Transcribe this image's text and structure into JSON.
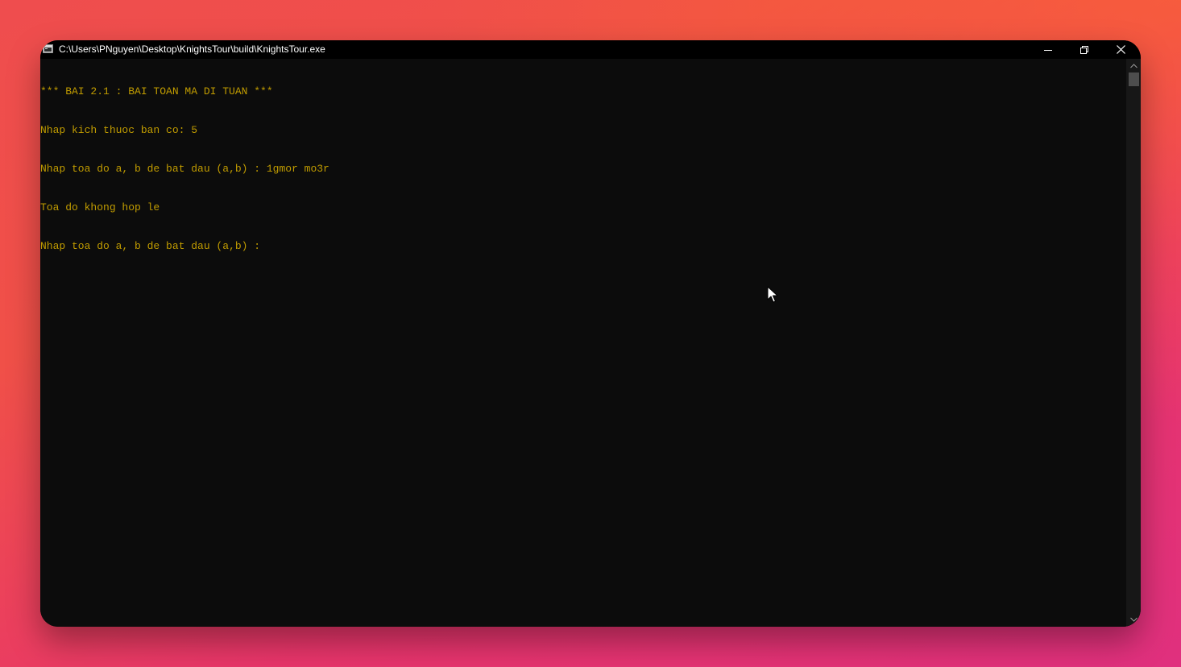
{
  "window": {
    "title": "C:\\Users\\PNguyen\\Desktop\\KnightsTour\\build\\KnightsTour.exe",
    "buttons": {
      "minimize": "minimize-icon",
      "restore": "restore-icon",
      "close": "close-icon"
    }
  },
  "console": {
    "text_color": "#c19c00",
    "background": "#0c0c0c",
    "lines": [
      "*** BAI 2.1 : BAI TOAN MA DI TUAN ***",
      "Nhap kich thuoc ban co: 5",
      "Nhap toa do a, b de bat dau (a,b) : 1gmor mo3r",
      "Toa do khong hop le",
      "Nhap toa do a, b de bat dau (a,b) : "
    ]
  },
  "scrollbar": {
    "up_icon": "chevron-up-icon",
    "down_icon": "chevron-down-icon"
  },
  "cursor_icon": "mouse-pointer-icon"
}
